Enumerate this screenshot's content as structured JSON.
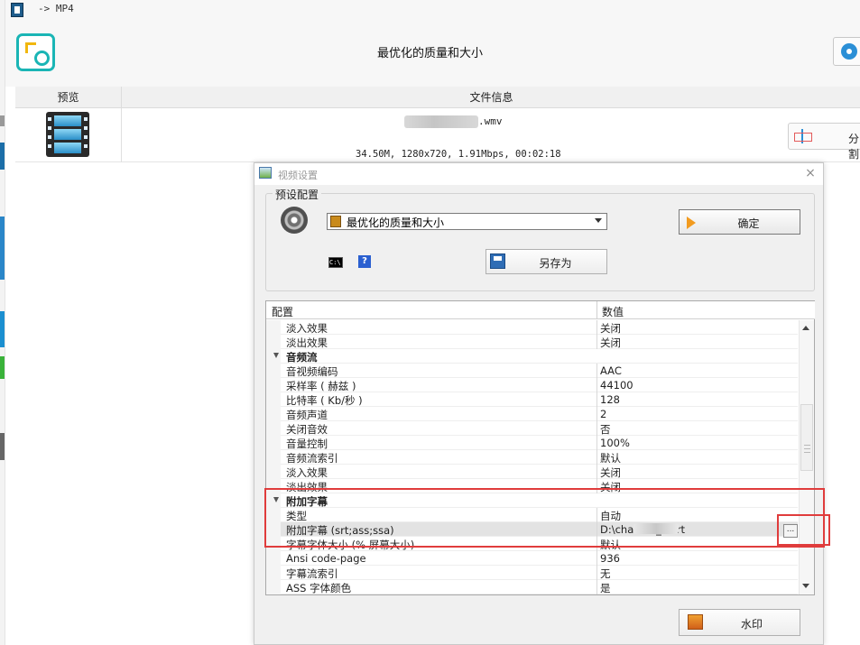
{
  "window": {
    "title": "-> MP4"
  },
  "header": {
    "title": "最优化的质量和大小",
    "settings_icon": "gear-icon"
  },
  "file_table": {
    "columns": {
      "preview": "预览",
      "info": "文件信息"
    },
    "file": {
      "name_suffix": ".wmv",
      "meta": "34.50M, 1280x720, 1.91Mbps, 00:02:18"
    },
    "split_button_label": "分割"
  },
  "dialog": {
    "title": "视频设置",
    "close_label": "×",
    "preset": {
      "group_label": "预设配置",
      "selected": "最优化的质量和大小",
      "confirm_label": "确定",
      "saveas_label": "另存为",
      "cmd_icon_text": "C:\\",
      "help_icon_text": "?"
    },
    "grid": {
      "header_name": "配置",
      "header_value": "数值",
      "rows": [
        {
          "name": "淡入效果",
          "value": "关闭"
        },
        {
          "name": "淡出效果",
          "value": "关闭"
        },
        {
          "name": "音频流",
          "value": "",
          "category": true
        },
        {
          "name": "音视频编码",
          "value": "AAC"
        },
        {
          "name": "采样率 ( 赫兹 )",
          "value": "44100"
        },
        {
          "name": "比特率 ( Kb/秒 )",
          "value": "128"
        },
        {
          "name": "音频声道",
          "value": "2"
        },
        {
          "name": "关闭音效",
          "value": "否"
        },
        {
          "name": "音量控制",
          "value": "100%"
        },
        {
          "name": "音频流索引",
          "value": "默认"
        },
        {
          "name": "淡入效果",
          "value": "关闭"
        },
        {
          "name": "淡出效果",
          "value": "关闭"
        },
        {
          "name": "附加字幕",
          "value": "",
          "category": true
        },
        {
          "name": "类型",
          "value": "自动"
        },
        {
          "name": "附加字幕 (srt;ass;ssa)",
          "value": "D:\\channel_1.srt",
          "selected": true
        },
        {
          "name": "字幕字体大小 (% 屏幕大小)",
          "value": "默认"
        },
        {
          "name": "Ansi code-page",
          "value": "936"
        },
        {
          "name": "字幕流索引",
          "value": "无"
        },
        {
          "name": "ASS 字体颜色",
          "value": "是"
        }
      ],
      "browse_label": "..."
    },
    "watermark_label": "水印"
  },
  "colors": {
    "highlight": "#e03c3c",
    "accent": "#1ab5b5",
    "link": "#2b8fd6"
  }
}
